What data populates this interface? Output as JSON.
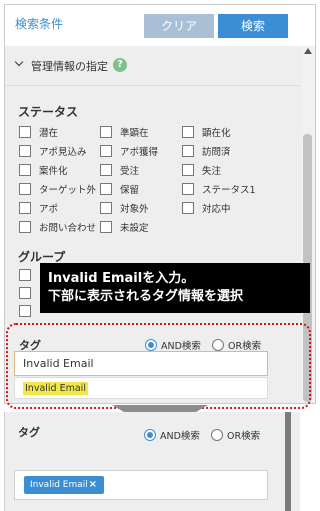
{
  "header": {
    "title": "検索条件",
    "clear_label": "クリア",
    "search_label": "検索"
  },
  "section": {
    "title": "管理情報の指定",
    "help": "?"
  },
  "status": {
    "label": "ステータス",
    "items": [
      "潜在",
      "準顕在",
      "顕在化",
      "アポ見込み",
      "アポ獲得",
      "訪問済",
      "案件化",
      "受注",
      "失注",
      "ターゲット外",
      "保留",
      "ステータス1",
      "アポ",
      "対象外",
      "対応中",
      "お問い合わせ",
      "未設定"
    ]
  },
  "group": {
    "label": "グループ"
  },
  "callout": {
    "line1": "Invalid Emailを入力。",
    "line2": "下部に表示されるタグ情報を選択"
  },
  "tag": {
    "label": "タグ",
    "and_label": "AND検索",
    "or_label": "OR検索",
    "input_value": "Invalid Email",
    "suggestion": "Invalid Email"
  },
  "tag_result": {
    "label": "タグ",
    "and_label": "AND検索",
    "or_label": "OR検索",
    "chip_label": "Invalid Email",
    "chip_remove": "×"
  },
  "colors": {
    "accent": "#3b8ed3",
    "highlight": "#d0161b",
    "suggest_bg": "#f2e84a"
  },
  "icons": [
    "chevron-down-icon",
    "help-icon",
    "arrow-down-icon",
    "remove-icon"
  ]
}
